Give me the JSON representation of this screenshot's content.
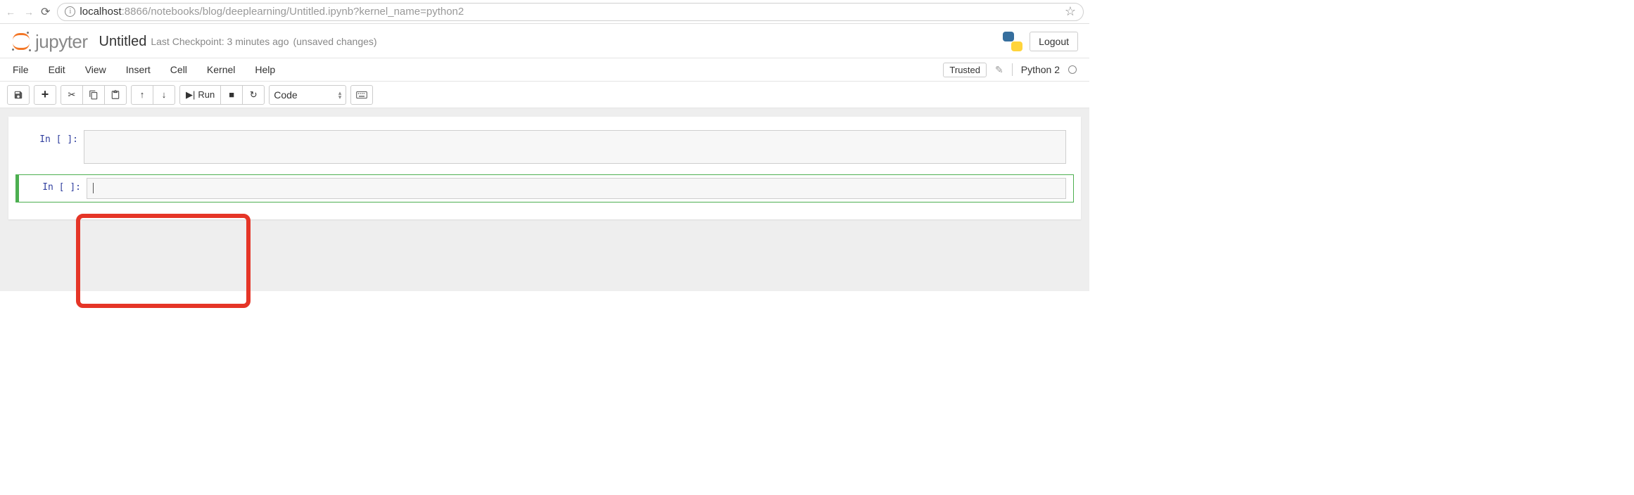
{
  "browser": {
    "url_host": "localhost",
    "url_port": ":8866",
    "url_path": "/notebooks/blog/deeplearning/Untitled.ipynb?kernel_name=python2"
  },
  "header": {
    "logo_text": "jupyter",
    "title": "Untitled",
    "checkpoint": "Last Checkpoint: 3 minutes ago",
    "unsaved": "(unsaved changes)",
    "logout": "Logout"
  },
  "menu": {
    "items": [
      "File",
      "Edit",
      "View",
      "Insert",
      "Cell",
      "Kernel",
      "Help"
    ],
    "trusted": "Trusted",
    "kernel_name": "Python 2"
  },
  "toolbar": {
    "run_label": "Run",
    "celltype_selected": "Code"
  },
  "cells": [
    {
      "prompt": "In [ ]:",
      "content": "",
      "active": false
    },
    {
      "prompt": "In [ ]:",
      "content": "",
      "active": true
    }
  ]
}
